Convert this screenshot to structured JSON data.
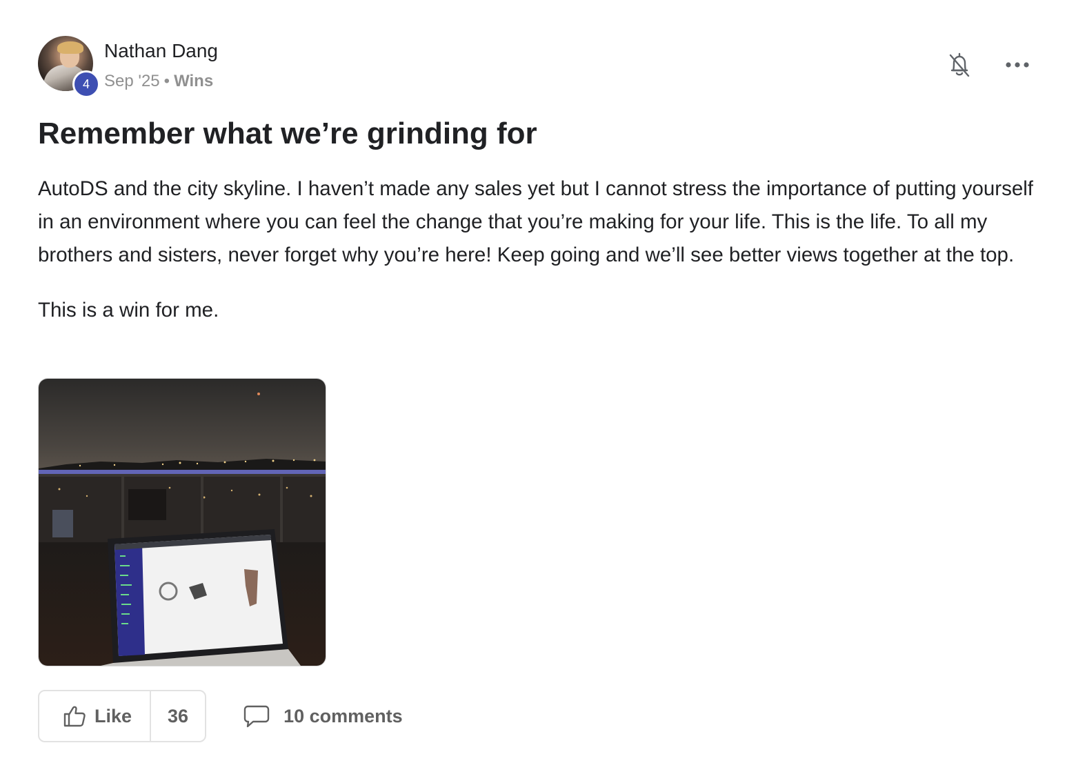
{
  "post": {
    "author": {
      "name": "Nathan Dang",
      "level": "4",
      "avatar_icon": "user-avatar"
    },
    "meta": {
      "date": "Sep '25",
      "separator": "•",
      "category": "Wins"
    },
    "header_actions": {
      "notifications_icon": "bell-off-icon",
      "more_icon": "more-horizontal-icon"
    },
    "title": "Remember what we’re grinding for",
    "body": [
      "AutoDS and the city skyline. I haven’t made any sales yet but I cannot stress the importance of putting yourself in an environment where you can feel the change that you’re making for your life. This is the life. To all my brothers and sisters, never forget why you’re here! Keep going and we’ll see better views together at the top.",
      "This is a win for me."
    ],
    "attachment": {
      "type": "image",
      "icon": "photo-laptop-city-skyline"
    },
    "actions": {
      "like_label": "Like",
      "like_count": "36",
      "like_icon": "thumbs-up-icon",
      "comments_label": "10 comments",
      "comments_icon": "comment-icon"
    }
  }
}
